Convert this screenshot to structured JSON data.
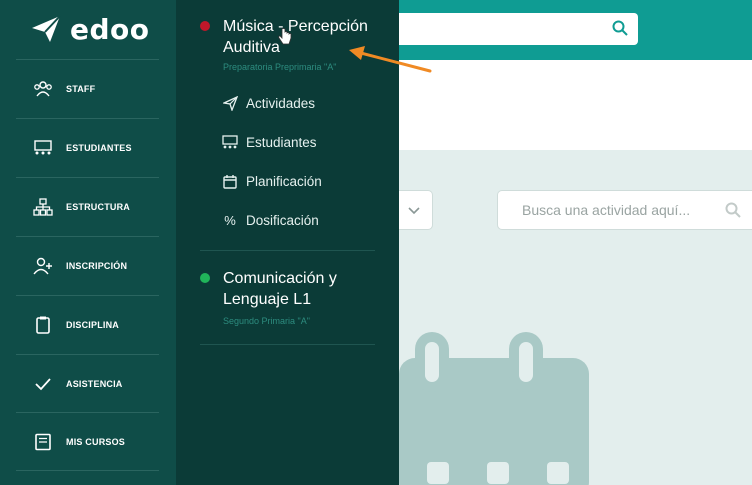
{
  "app": {
    "logo_text": "edoo"
  },
  "nav": {
    "items": [
      {
        "label": "STAFF",
        "icon": "staff-icon"
      },
      {
        "label": "ESTUDIANTES",
        "icon": "students-icon"
      },
      {
        "label": "ESTRUCTURA",
        "icon": "structure-icon"
      },
      {
        "label": "INSCRIPCIÓN",
        "icon": "add-user-icon"
      },
      {
        "label": "DISCIPLINA",
        "icon": "clipboard-icon"
      },
      {
        "label": "ASISTENCIA",
        "icon": "check-icon"
      },
      {
        "label": "MIS CURSOS",
        "icon": "book-icon"
      }
    ]
  },
  "courses": [
    {
      "name": "Música - Percepción Auditiva",
      "subtitle": "Preparatoria Preprimaria \"A\"",
      "status_color": "#c0182a",
      "menu": [
        {
          "label": "Actividades",
          "icon": "paper-plane-icon"
        },
        {
          "label": "Estudiantes",
          "icon": "students-icon"
        },
        {
          "label": "Planificación",
          "icon": "calendar-icon"
        },
        {
          "label": "Dosificación",
          "icon": "percent-icon"
        }
      ]
    },
    {
      "name": "Comunicación y Lenguaje L1",
      "subtitle": "Segundo Primaria \"A\"",
      "status_color": "#20b45a"
    }
  ],
  "search": {
    "placeholder": ""
  },
  "activities": {
    "search_placeholder": "Busca una actividad aquí..."
  },
  "colors": {
    "sidebar": "#0f4d48",
    "panel": "#0b3b37",
    "topbar": "#0f9c93",
    "annotation_arrow": "#f08a24"
  }
}
